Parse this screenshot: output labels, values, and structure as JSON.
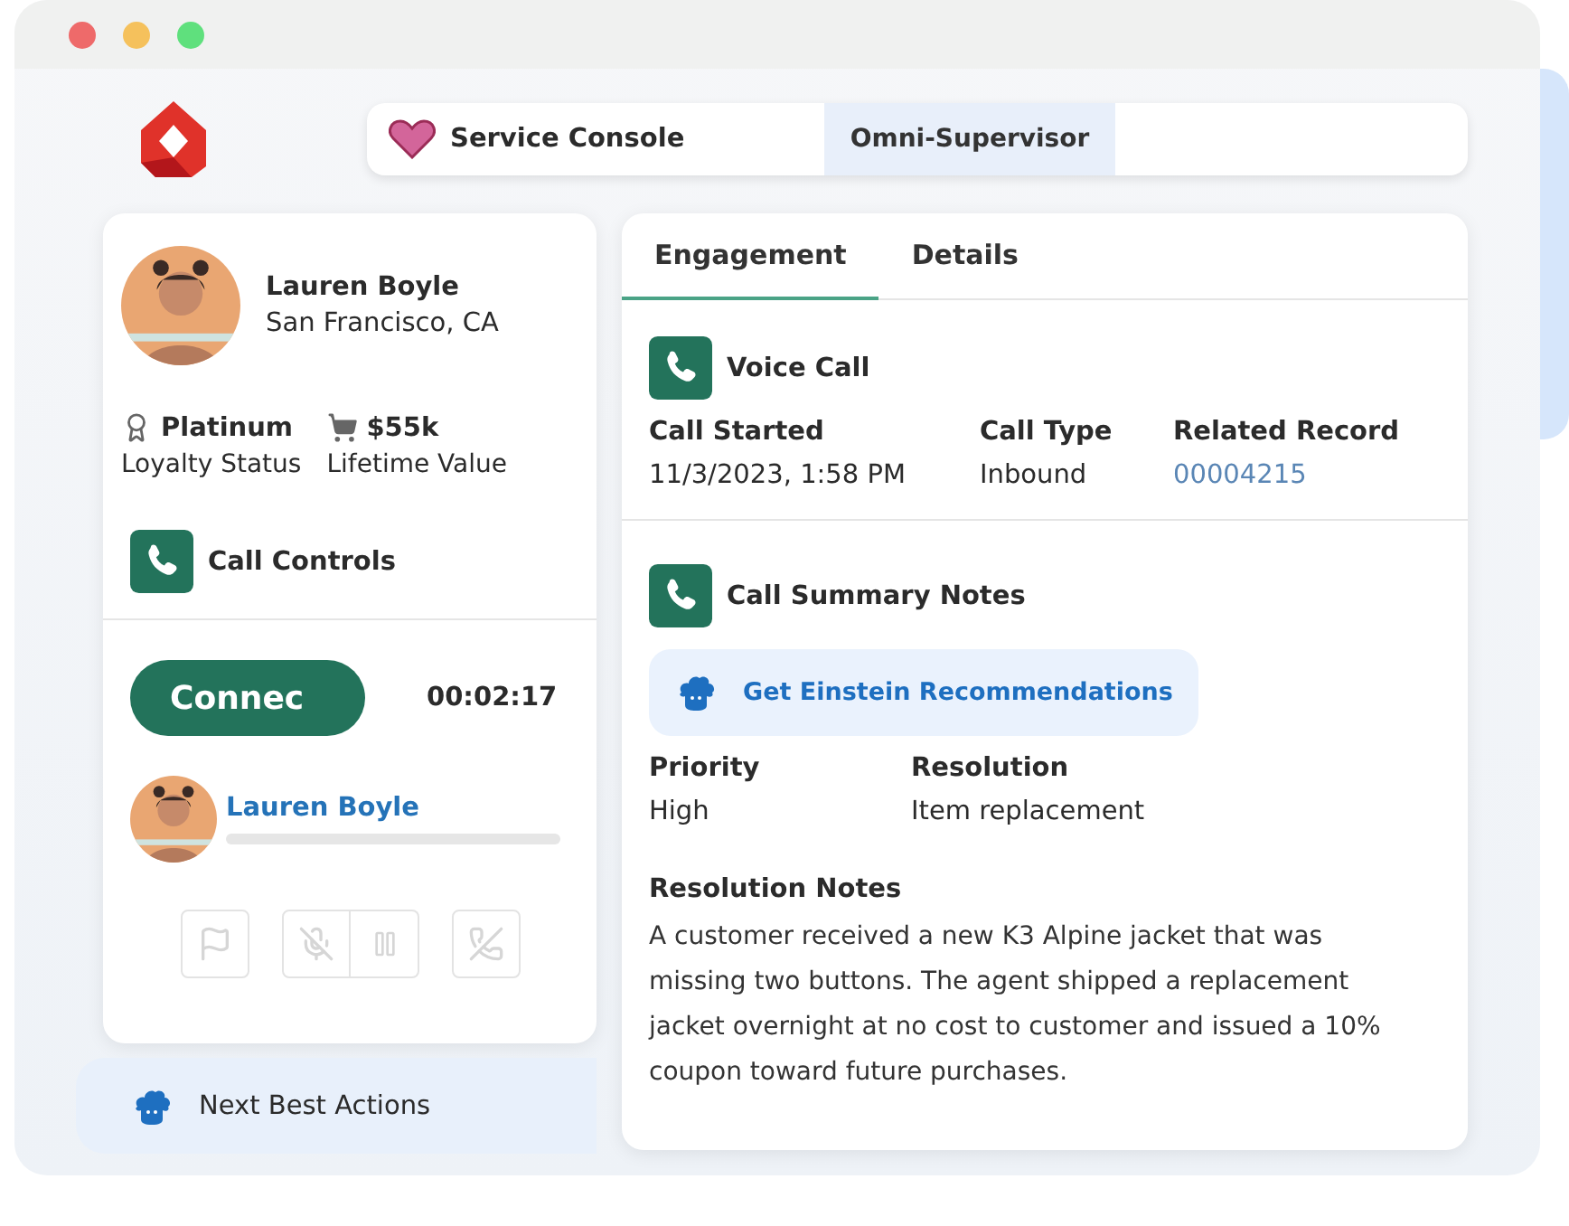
{
  "top_bar": {
    "app_name": "Service Console",
    "segments": [
      {
        "label": "Omni-Supervisor",
        "selected": true
      }
    ]
  },
  "customer": {
    "name": "Lauren Boyle",
    "location": "San Francisco, CA",
    "stats": [
      {
        "kind": "award",
        "value": "Platinum",
        "label": "Loyalty Status"
      },
      {
        "kind": "cart",
        "value": "$55k",
        "label": "Lifetime Value"
      }
    ]
  },
  "call_controls": {
    "title": "Call Controls",
    "connect_label": "Connec",
    "timer": "00:02:17",
    "participant": "Lauren Boyle",
    "button_groups": [
      [
        {
          "kind": "flag",
          "disabled": true
        }
      ],
      [
        {
          "kind": "mute",
          "disabled": true
        },
        {
          "kind": "hold",
          "disabled": true
        }
      ],
      [
        {
          "kind": "hangup",
          "disabled": true
        }
      ]
    ]
  },
  "next_best_actions": {
    "label": "Next Best Actions"
  },
  "tabs": [
    {
      "label": "Engagement",
      "selected": true
    },
    {
      "label": "Details",
      "selected": false
    }
  ],
  "voice_call": {
    "title": "Voice Call",
    "fields": [
      {
        "label": "Call Started",
        "value": "11/3/2023, 1:58 PM",
        "kind": "text"
      },
      {
        "label": "Call Type",
        "value": "Inbound",
        "kind": "text"
      },
      {
        "label": "Related Record",
        "value": "00004215",
        "kind": "link"
      }
    ]
  },
  "summary": {
    "title": "Call Summary Notes",
    "einstein_button": "Get Einstein Recommendations",
    "fields": [
      {
        "label": "Priority",
        "value": "High"
      },
      {
        "label": "Resolution",
        "value": "Item replacement"
      }
    ],
    "notes_label": "Resolution Notes",
    "notes": "A customer received a new K3 Alpine jacket that was missing two buttons. The agent shipped a replacement jacket overnight at no cost to customer and issued a 10% coupon toward future purchases."
  }
}
